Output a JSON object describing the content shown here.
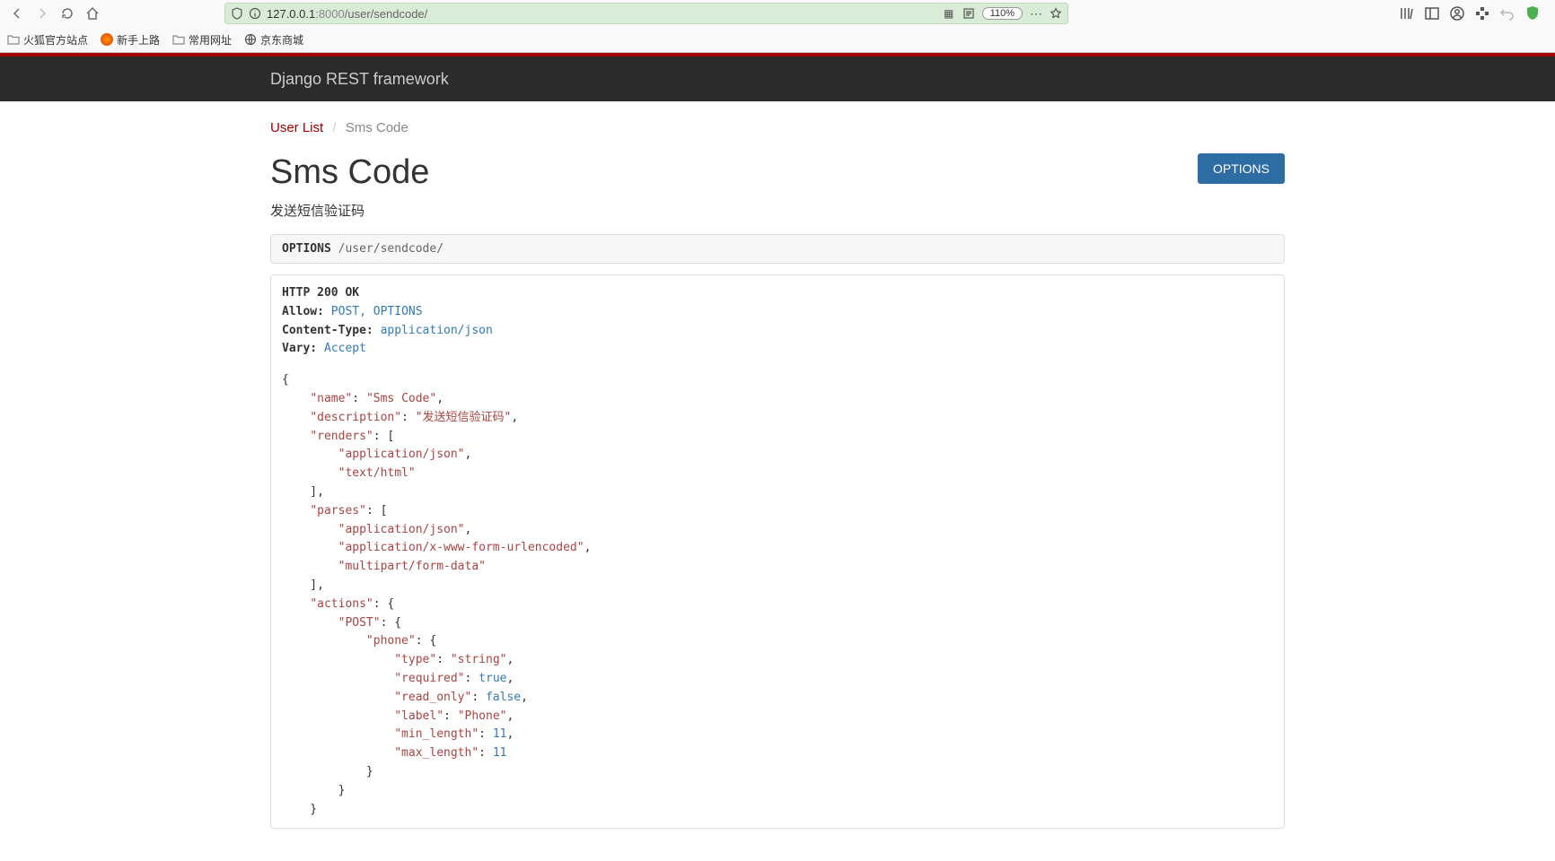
{
  "browser": {
    "url_host": "127.0.0.1",
    "url_port": ":8000",
    "url_path": "/user/sendcode/",
    "zoom": "110%"
  },
  "bookmarks": [
    "火狐官方站点",
    "新手上路",
    "常用网址",
    "京东商城"
  ],
  "drf": {
    "brand": "Django REST framework"
  },
  "breadcrumb": {
    "root": "User List",
    "current": "Sms Code"
  },
  "page": {
    "title": "Sms Code",
    "description": "发送短信验证码",
    "options_label": "OPTIONS"
  },
  "request": {
    "method": "OPTIONS",
    "path": "/user/sendcode/"
  },
  "response": {
    "status": "HTTP 200 OK",
    "headers": {
      "allow_key": "Allow:",
      "allow_val": "POST, OPTIONS",
      "ct_key": "Content-Type:",
      "ct_val": "application/json",
      "vary_key": "Vary:",
      "vary_val": "Accept"
    }
  },
  "json_body": {
    "name": "Sms Code",
    "description": "发送短信验证码",
    "renders": [
      "application/json",
      "text/html"
    ],
    "parses": [
      "application/json",
      "application/x-www-form-urlencoded",
      "multipart/form-data"
    ],
    "actions": {
      "POST": {
        "phone": {
          "type": "string",
          "required": true,
          "read_only": false,
          "label": "Phone",
          "min_length": 11,
          "max_length": 11
        }
      }
    }
  }
}
